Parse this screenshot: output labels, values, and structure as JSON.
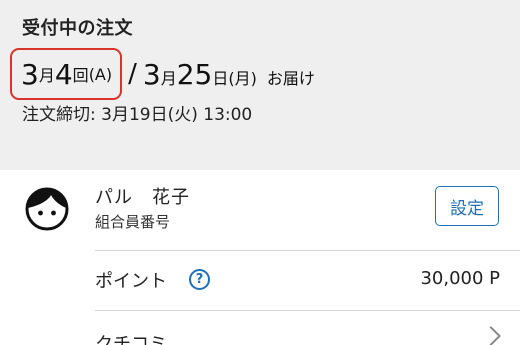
{
  "order": {
    "heading": "受付中の注文",
    "round": {
      "month": "3",
      "month_unit": "月",
      "number": "4",
      "number_unit": "回",
      "code": "(A)"
    },
    "slash": "/",
    "delivery": {
      "month": "3",
      "month_unit": "月",
      "day": "25",
      "day_unit": "日",
      "weekday": "(月)",
      "suffix": "お届け"
    },
    "deadline": "注文締切: 3月19日(火) 13:00",
    "highlight_color": "#d9342b"
  },
  "profile": {
    "name": "パル　花子",
    "member_label": "組合員番号",
    "settings_label": "設定",
    "avatar_icon": "person-face-icon"
  },
  "points": {
    "label": "ポイント",
    "help_icon": "?",
    "value": "30,000 P"
  },
  "review": {
    "label": "クチコミ",
    "chevron_icon": "chevron-right-icon"
  },
  "colors": {
    "accent": "#1e6fb8",
    "panel_bg": "#efefef"
  }
}
